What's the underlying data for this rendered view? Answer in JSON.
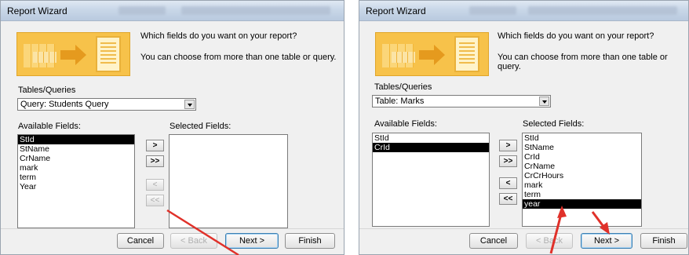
{
  "left": {
    "title": "Report Wizard",
    "question1": "Which fields do you want on your report?",
    "question2": "You can choose from more than one table or query.",
    "tables_label": "Tables/Queries",
    "tables_value": "Query: Students Query",
    "available_label": "Available Fields:",
    "selected_label": "Selected Fields:",
    "available_fields": [
      "StId",
      "StName",
      "CrName",
      "mark",
      "term",
      "Year"
    ],
    "selected_available": "StId",
    "selected_fields": [],
    "move_buttons": [
      ">",
      ">>",
      "<",
      "<<"
    ],
    "buttons": {
      "cancel": "Cancel",
      "back": "< Back",
      "next": "Next >",
      "finish": "Finish"
    }
  },
  "right": {
    "title": "Report Wizard",
    "question1": "Which fields do you want on your report?",
    "question2": "You can choose from more than one table or query.",
    "tables_label": "Tables/Queries",
    "tables_value": "Table: Marks",
    "available_label": "Available Fields:",
    "selected_label": "Selected Fields:",
    "available_fields": [
      "StId",
      "CrId"
    ],
    "selected_available": "CrId",
    "selected_fields": [
      "StId",
      "StName",
      "CrId",
      "CrName",
      "CrCrHours",
      "mark",
      "term",
      "year"
    ],
    "selected_highlight": "year",
    "move_buttons": [
      ">",
      ">>",
      "<",
      "<<"
    ],
    "buttons": {
      "cancel": "Cancel",
      "back": "< Back",
      "next": "Next >",
      "finish": "Finish"
    }
  },
  "colors": {
    "annotation_arrow": "#e0312a",
    "selection": "#000000"
  }
}
